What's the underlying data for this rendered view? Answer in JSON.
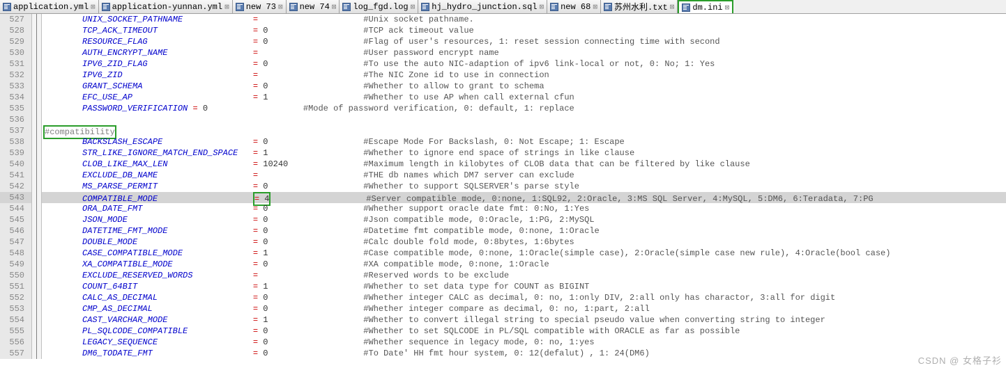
{
  "tabs": [
    {
      "label": "application.yml",
      "active": false
    },
    {
      "label": "application-yunnan.yml",
      "active": false
    },
    {
      "label": "new 73",
      "active": false
    },
    {
      "label": "new 74",
      "active": false
    },
    {
      "label": "log_fgd.log",
      "active": false
    },
    {
      "label": "hj_hydro_junction.sql",
      "active": false
    },
    {
      "label": "new 68",
      "active": false
    },
    {
      "label": "苏州水利.txt",
      "active": false
    },
    {
      "label": "dm.ini",
      "active": true
    }
  ],
  "watermark": "CSDN @ 女格子衫",
  "lines": [
    {
      "n": 527,
      "name": "UNIX_SOCKET_PATHNAME",
      "op": "=",
      "val": "",
      "cmt": "#Unix socket pathname."
    },
    {
      "n": 528,
      "name": "TCP_ACK_TIMEOUT",
      "op": "=",
      "val": "0",
      "cmt": "#TCP ack timeout value"
    },
    {
      "n": 529,
      "name": "RESOURCE_FLAG",
      "op": "=",
      "val": "0",
      "cmt": "#Flag of user's resources, 1: reset session connecting time with second"
    },
    {
      "n": 530,
      "name": "AUTH_ENCRYPT_NAME",
      "op": "=",
      "val": "",
      "cmt": "#User password encrypt name"
    },
    {
      "n": 531,
      "name": "IPV6_ZID_FLAG",
      "op": "=",
      "val": "0",
      "cmt": "#To use the auto NIC-adaption of ipv6 link-local or not, 0: No; 1: Yes"
    },
    {
      "n": 532,
      "name": "IPV6_ZID",
      "op": "=",
      "val": "",
      "cmt": "#The NIC Zone id to use in connection"
    },
    {
      "n": 533,
      "name": "GRANT_SCHEMA",
      "op": "=",
      "val": "0",
      "cmt": "#Whether to allow to grant to schema"
    },
    {
      "n": 534,
      "name": "EFC_USE_AP",
      "op": "=",
      "val": "1",
      "cmt": "#Whether to use AP when call external cfun"
    },
    {
      "n": 535,
      "name": "PASSWORD_VERIFICATION",
      "op": "=",
      "val": "0",
      "cmt": "#Mode of password verification, 0: default, 1: replace",
      "tight": true
    },
    {
      "n": 536,
      "blank": true
    },
    {
      "n": 537,
      "section": "#compatibility",
      "boxed": true
    },
    {
      "n": 538,
      "name": "BACKSLASH_ESCAPE",
      "op": "=",
      "val": "0",
      "cmt": "#Escape Mode For Backslash, 0: Not Escape; 1: Escape"
    },
    {
      "n": 539,
      "name": "STR_LIKE_IGNORE_MATCH_END_SPACE",
      "op": "=",
      "val": "1",
      "cmt": "#Whether to ignore end space of strings in like clause"
    },
    {
      "n": 540,
      "name": "CLOB_LIKE_MAX_LEN",
      "op": "=",
      "val": "10240",
      "cmt": "#Maximum length in kilobytes of CLOB data that can be filtered by like clause"
    },
    {
      "n": 541,
      "name": "EXCLUDE_DB_NAME",
      "op": "=",
      "val": "",
      "cmt": "#THE db names which DM7 server can exclude"
    },
    {
      "n": 542,
      "name": "MS_PARSE_PERMIT",
      "op": "=",
      "val": "0",
      "cmt": "#Whether to support SQLSERVER's parse style"
    },
    {
      "n": 543,
      "name": "COMPATIBLE_MODE",
      "op": "=",
      "val": "4",
      "cmt": "#Server compatible mode, 0:none, 1:SQL92, 2:Oracle, 3:MS SQL Server, 4:MySQL, 5:DM6, 6:Teradata, 7:PG",
      "hl": true,
      "boxval": true
    },
    {
      "n": 544,
      "name": "ORA_DATE_FMT",
      "op": "=",
      "val": "0",
      "cmt": "#Whether support oracle date fmt: 0:No, 1:Yes"
    },
    {
      "n": 545,
      "name": "JSON_MODE",
      "op": "=",
      "val": "0",
      "cmt": "#Json compatible mode, 0:Oracle, 1:PG, 2:MySQL"
    },
    {
      "n": 546,
      "name": "DATETIME_FMT_MODE",
      "op": "=",
      "val": "0",
      "cmt": "#Datetime fmt compatible mode, 0:none, 1:Oracle"
    },
    {
      "n": 547,
      "name": "DOUBLE_MODE",
      "op": "=",
      "val": "0",
      "cmt": "#Calc double fold mode, 0:8bytes, 1:6bytes"
    },
    {
      "n": 548,
      "name": "CASE_COMPATIBLE_MODE",
      "op": "=",
      "val": "1",
      "cmt": "#Case compatible mode, 0:none, 1:Oracle(simple case), 2:Oracle(simple case new rule), 4:Oracle(bool case)"
    },
    {
      "n": 549,
      "name": "XA_COMPATIBLE_MODE",
      "op": "=",
      "val": "0",
      "cmt": "#XA compatible mode, 0:none, 1:Oracle"
    },
    {
      "n": 550,
      "name": "EXCLUDE_RESERVED_WORDS",
      "op": "=",
      "val": "",
      "cmt": "#Reserved words to be exclude"
    },
    {
      "n": 551,
      "name": "COUNT_64BIT",
      "op": "=",
      "val": "1",
      "cmt": "#Whether to set data type for COUNT as BIGINT"
    },
    {
      "n": 552,
      "name": "CALC_AS_DECIMAL",
      "op": "=",
      "val": "0",
      "cmt": "#Whether integer CALC as decimal, 0: no, 1:only DIV, 2:all only has charactor, 3:all for digit"
    },
    {
      "n": 553,
      "name": "CMP_AS_DECIMAL",
      "op": "=",
      "val": "0",
      "cmt": "#Whether integer compare as decimal, 0: no, 1:part, 2:all"
    },
    {
      "n": 554,
      "name": "CAST_VARCHAR_MODE",
      "op": "=",
      "val": "1",
      "cmt": "#Whether to convert illegal string to special pseudo value when converting string to integer"
    },
    {
      "n": 555,
      "name": "PL_SQLCODE_COMPATIBLE",
      "op": "=",
      "val": "0",
      "cmt": "#Whether to set SQLCODE in PL/SQL compatible with ORACLE as far as possible"
    },
    {
      "n": 556,
      "name": "LEGACY_SEQUENCE",
      "op": "=",
      "val": "0",
      "cmt": "#Whether sequence in legacy mode, 0: no, 1:yes"
    },
    {
      "n": 557,
      "name": "DM6_TODATE_FMT",
      "op": "=",
      "val": "0",
      "cmt": "#To Date' HH fmt hour system, 0: 12(defalut) , 1: 24(DM6)"
    }
  ]
}
